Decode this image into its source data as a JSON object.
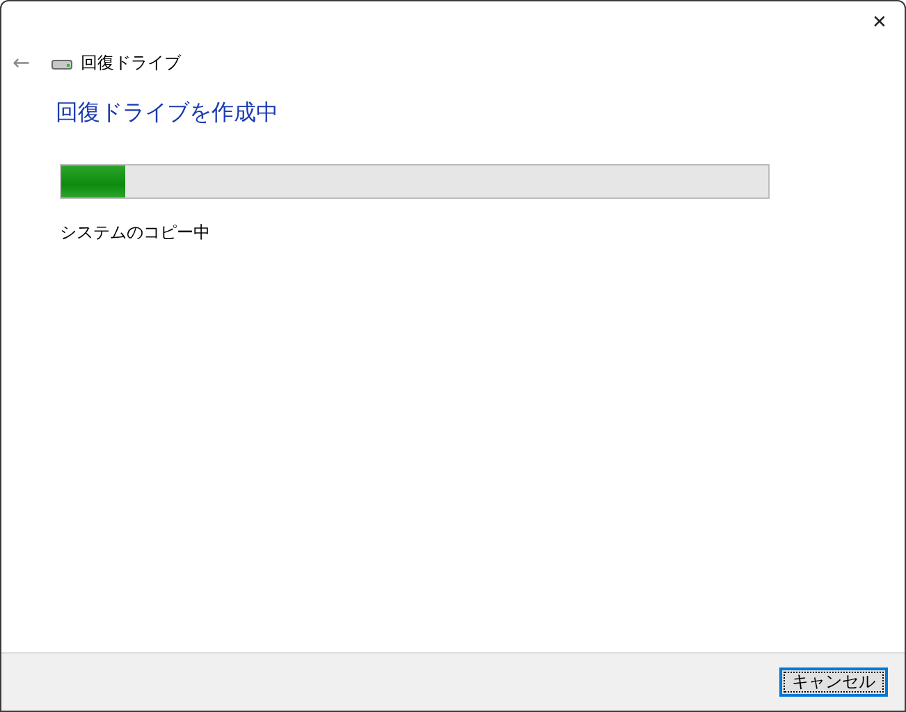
{
  "window": {
    "close": "✕"
  },
  "nav": {
    "back": "←",
    "title": "回復ドライブ"
  },
  "heading": "回復ドライブを作成中",
  "progress": {
    "level": 0.09
  },
  "status": "システムのコピー中",
  "buttons": [
    {
      "label": "キャンセル",
      "focused": true
    }
  ]
}
